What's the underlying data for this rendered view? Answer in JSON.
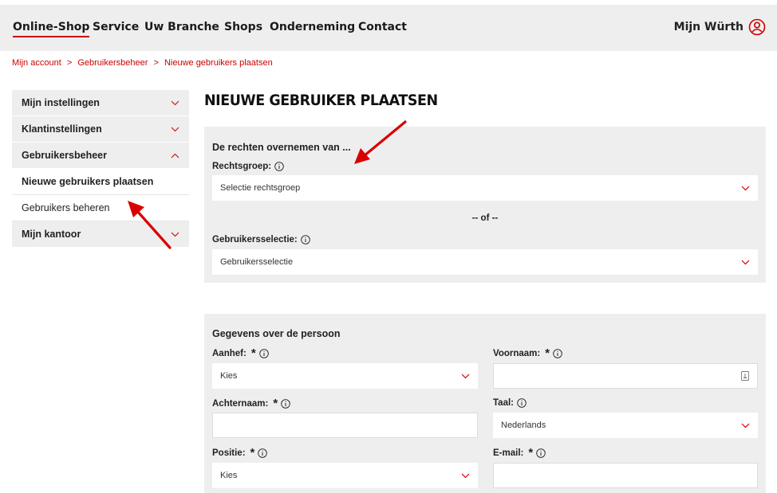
{
  "nav": {
    "items": [
      "Online-Shop",
      "Service",
      "Uw Branche",
      "Shops",
      "Onderneming",
      "Contact"
    ],
    "account_label": "Mijn Würth"
  },
  "breadcrumb": [
    "Mijn account",
    ">",
    "Gebruikersbeheer",
    ">",
    "Nieuwe gebruikers plaatsen"
  ],
  "sidebar": {
    "items": [
      {
        "label": "Mijn instellingen"
      },
      {
        "label": "Klantinstellingen"
      },
      {
        "label": "Gebruikersbeheer"
      },
      {
        "label": "Nieuwe gebruikers plaatsen"
      },
      {
        "label": "Gebruikers beheren"
      },
      {
        "label": "Mijn kantoor"
      }
    ]
  },
  "page": {
    "title": "NIEUWE GEBRUIKER PLAATSEN"
  },
  "rights": {
    "heading": "De rechten overnemen van ...",
    "group_label": "Rechtsgroep:",
    "group_value": "Selectie rechtsgroep",
    "or_text": "-- of --",
    "user_label": "Gebruikersselectie:",
    "user_value": "Gebruikersselectie"
  },
  "person": {
    "heading": "Gegevens over de persoon",
    "salutation_label": "Aanhef:",
    "salutation_value": "Kies",
    "firstname_label": "Voornaam:",
    "firstname_value": "",
    "lastname_label": "Achternaam:",
    "lastname_value": "",
    "language_label": "Taal:",
    "language_value": "Nederlands",
    "position_label": "Positie:",
    "position_value": "Kies",
    "email_label": "E-mail:",
    "email_value": "",
    "required_mark": "*"
  },
  "colors": {
    "accent": "#cc0000",
    "panel": "#eeeeee"
  }
}
